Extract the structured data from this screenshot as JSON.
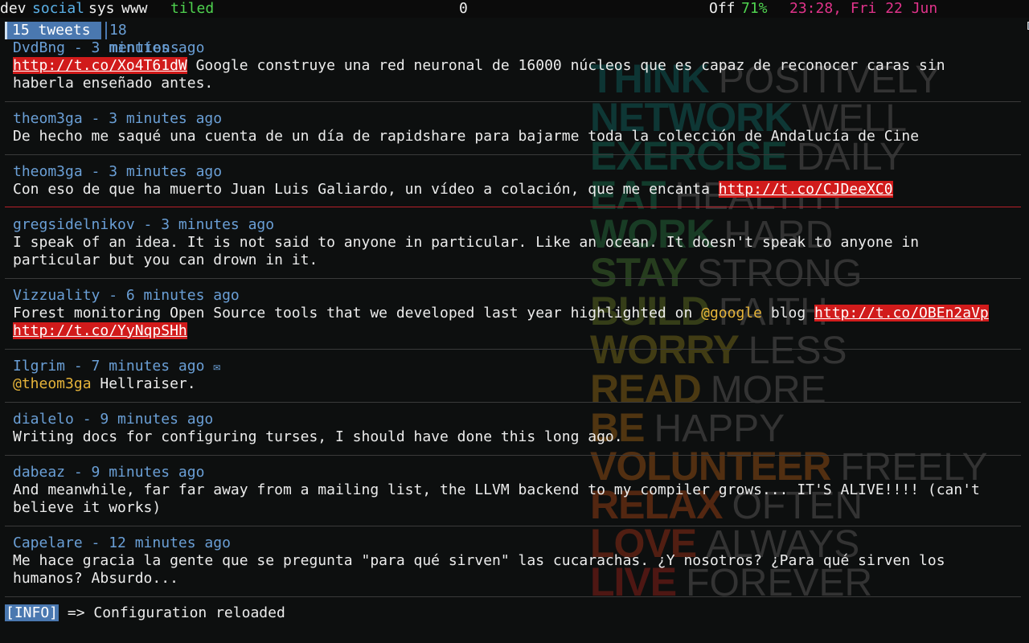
{
  "topbar": {
    "workspaces": [
      {
        "label": "dev",
        "active": false
      },
      {
        "label": "social",
        "active": true
      },
      {
        "label": "sys",
        "active": false
      },
      {
        "label": "www",
        "active": false
      }
    ],
    "layout": "tiled",
    "counter": "0",
    "battery_state": "Off",
    "battery_pct": "71%",
    "clock": "23:28, Fri 22 Jun",
    "tray_icons": [
      "network-monitor-icon",
      "clipboard-icon"
    ]
  },
  "tabs": {
    "active": "15 tweets",
    "inactive": "18 mentions"
  },
  "tweets": [
    {
      "header": "DvdBng - 3 minutes ago",
      "line1_url": "http://t.co/Xo4T61dW",
      "line1_rest": " Google construye una red neuronal de 16000 núcleos que es capaz de reconocer caras sin",
      "line2": "haberla enseñado antes."
    },
    {
      "header": "theom3ga - 3 minutes ago",
      "text": "De hecho me saqué una cuenta de un día de rapidshare para bajarme toda la colección de Andalucía de Cine"
    },
    {
      "header": "theom3ga - 3 minutes ago",
      "text": "Con eso de que ha muerto Juan Luis Galiardo, un vídeo a colación, que me encanta ",
      "url": "http://t.co/CJDeeXC0"
    },
    {
      "header": "gregsidelnikov - 3 minutes ago",
      "text": "I speak of an idea. It is not said to anyone in particular. Like an ocean. It doesn't speak to anyone in\nparticular but you can drown in it."
    },
    {
      "header": "Vizzuality - 6 minutes ago",
      "text_a": "Forest monitoring Open Source tools that we developed last year highlighted on ",
      "mention": "@google",
      "text_b": " blog ",
      "url1": "http://t.co/OBEn2aVp",
      "url2": "http://t.co/YyNqpSHh"
    },
    {
      "header": "Ilgrim - 7 minutes ago",
      "mail_icon": "✉",
      "mention": "@theom3ga",
      "text": " Hellraiser."
    },
    {
      "header": "dialelo - 9 minutes ago",
      "text": "Writing docs for configuring turses, I should have done this long ago."
    },
    {
      "header": "dabeaz - 9 minutes ago",
      "text": "And meanwhile, far far away from a mailing list, the LLVM backend to my compiler grows... IT'S ALIVE!!!! (can't\nbelieve it works)"
    },
    {
      "header": "Capelare - 12 minutes ago",
      "text": "Me hace gracia la gente que se pregunta \"para qué sirven\" las cucarachas. ¿Y nosotros? ¿Para qué sirven los\nhumanos? Absurdo..."
    }
  ],
  "status": {
    "tag": "[INFO]",
    "message": " => Configuration reloaded"
  },
  "wallpaper": {
    "rows": [
      {
        "bold": "THINK",
        "light": "POSITIVELY",
        "color": "#0f6b68"
      },
      {
        "bold": "NETWORK",
        "light": "WELL",
        "color": "#11706a"
      },
      {
        "bold": "EXERCISE",
        "light": "DAILY",
        "color": "#137664"
      },
      {
        "bold": "EAT",
        "light": "HEALTHY",
        "color": "#1a7a55"
      },
      {
        "bold": "WORK",
        "light": "HARD",
        "color": "#2a7c45"
      },
      {
        "bold": "STAY",
        "light": "STRONG",
        "color": "#4a7e33"
      },
      {
        "bold": "BUILD",
        "light": "FAITH",
        "color": "#6c7e25"
      },
      {
        "bold": "WORRY",
        "light": "LESS",
        "color": "#8a7a1c"
      },
      {
        "bold": "READ",
        "light": "MORE",
        "color": "#a07418"
      },
      {
        "bold": "BE",
        "light": "HAPPY",
        "color": "#ac6a16"
      },
      {
        "bold": "VOLUNTEER",
        "light": "FREELY",
        "color": "#b25c14"
      },
      {
        "bold": "RELAX",
        "light": "OFTEN",
        "color": "#b44816"
      },
      {
        "bold": "LOVE",
        "light": "ALWAYS",
        "color": "#b03418"
      },
      {
        "bold": "LIVE",
        "light": "FOREVER",
        "color": "#a8241a"
      }
    ]
  }
}
